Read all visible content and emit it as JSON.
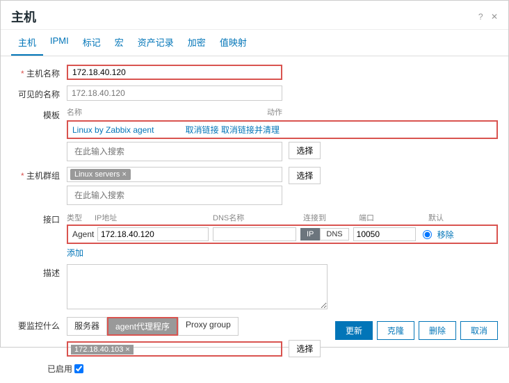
{
  "dialog": {
    "title": "主机"
  },
  "tabs": [
    "主机",
    "IPMI",
    "标记",
    "宏",
    "资产记录",
    "加密",
    "值映射"
  ],
  "labels": {
    "hostname": "主机名称",
    "visiblename": "可见的名称",
    "templates": "模板",
    "hostgroups": "主机群组",
    "interfaces": "接口",
    "description": "描述",
    "monitored_by": "要监控什么",
    "enabled": "已启用"
  },
  "fields": {
    "hostname": "172.18.40.120",
    "visiblename_placeholder": "172.18.40.120",
    "template_header_name": "名称",
    "template_header_action": "动作",
    "template_name": "Linux by Zabbix agent",
    "template_unlink": "取消链接",
    "template_unlink_clear": "取消链接并清理",
    "search_placeholder": "在此输入搜索",
    "select_btn": "选择",
    "hostgroup_tag": "Linux servers ×",
    "iface_headers": {
      "type": "类型",
      "ip": "IP地址",
      "dns": "DNS名称",
      "connect": "连接到",
      "port": "端口",
      "default": "默认"
    },
    "iface": {
      "type": "Agent",
      "ip": "172.18.40.120",
      "dns": "",
      "conn_ip": "IP",
      "conn_dns": "DNS",
      "port": "10050",
      "remove": "移除"
    },
    "add_link": "添加",
    "monitored_opts": {
      "server": "服务器",
      "proxy": "agent代理程序",
      "proxy_group": "Proxy group"
    },
    "proxy_value": "172.18.40.103 ×"
  },
  "footer": {
    "update": "更新",
    "clone": "克隆",
    "delete": "删除",
    "cancel": "取消"
  }
}
